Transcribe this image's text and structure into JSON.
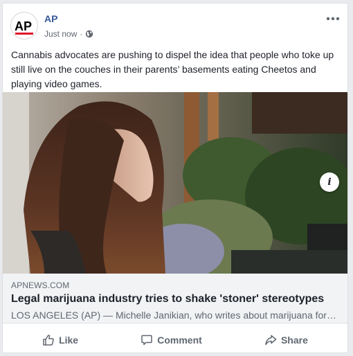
{
  "post": {
    "author": "AP",
    "avatar_text": "AP",
    "timestamp": "Just now",
    "separator": "·",
    "privacy_icon": "globe-icon",
    "caption": "Cannabis advocates are pushing to dispel the idea that people who toke up still live on the couches in their parents’ basements eating Cheetos and playing video games."
  },
  "link_preview": {
    "domain": "APNEWS.COM",
    "title": "Legal marijuana industry tries to shake 'stoner' stereotypes",
    "description": "LOS ANGELES (AP) — Michelle Janikian, who writes about marijuana for…",
    "info_label": "i"
  },
  "actions": {
    "like_label": "Like",
    "comment_label": "Comment",
    "share_label": "Share"
  },
  "colors": {
    "author_blue": "#365899",
    "ap_red": "#e0162b",
    "muted_text": "#606770"
  }
}
